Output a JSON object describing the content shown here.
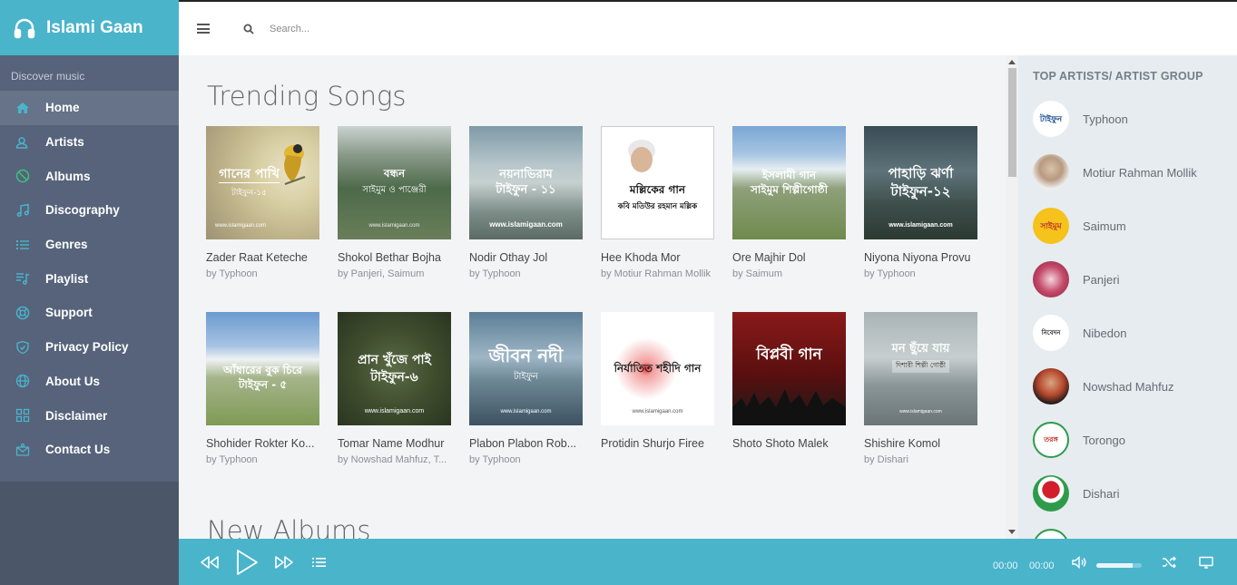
{
  "brand": {
    "title": "Islami Gaan"
  },
  "search": {
    "placeholder": "Search..."
  },
  "sidebar": {
    "caption": "Discover music",
    "items": [
      {
        "label": "Home",
        "icon": "home-icon"
      },
      {
        "label": "Artists",
        "icon": "users-icon"
      },
      {
        "label": "Albums",
        "icon": "disc-icon"
      },
      {
        "label": "Discography",
        "icon": "music-note-icon"
      },
      {
        "label": "Genres",
        "icon": "list-icon"
      },
      {
        "label": "Playlist",
        "icon": "playlist-icon"
      },
      {
        "label": "Support",
        "icon": "support-icon"
      },
      {
        "label": "Privacy Policy",
        "icon": "shield-icon"
      },
      {
        "label": "About Us",
        "icon": "globe-icon"
      },
      {
        "label": "Disclaimer",
        "icon": "grid-icon"
      },
      {
        "label": "Contact Us",
        "icon": "contact-icon"
      }
    ]
  },
  "main": {
    "trending_title": "Trending Songs",
    "new_albums_title": "New Albums",
    "row1": [
      {
        "title": "Zader Raat Keteche",
        "artist": "by Typhoon",
        "cover_title": "গানের পাখি",
        "cover_sub": "টাইফুন-১৫",
        "watermark": "www.islamigaan.com"
      },
      {
        "title": "Shokol Bethar Bojha",
        "artist": "by Panjeri, Saimum",
        "cover_title": "বন্ধন",
        "cover_sub": "সাইমুম ও পাঞ্জেরী",
        "watermark": "www.islamigaan.com"
      },
      {
        "title": "Nodir Othay Jol",
        "artist": "by Typhoon",
        "cover_title": "নয়নাভিরাম",
        "cover_sub": "টাইফুন - ১১",
        "watermark": "www.islamigaan.com"
      },
      {
        "title": "Hee Khoda Mor",
        "artist": "by Motiur Rahman Mollik",
        "cover_title": "মল্লিকের গান",
        "cover_sub": "কবি মতিউর রহমান মল্লিক",
        "watermark": ""
      },
      {
        "title": "Ore Majhir Dol",
        "artist": "by Saimum",
        "cover_title": "ইসলামী গান",
        "cover_sub": "সাইমুম শিল্পীগোষ্ঠী",
        "watermark": ""
      },
      {
        "title": "Niyona Niyona Provu",
        "artist": "by Typhoon",
        "cover_title": "পাহাড়ি ঝর্ণা",
        "cover_sub": "টাইফুন-১২",
        "watermark": "www.islamigaan.com"
      }
    ],
    "row2": [
      {
        "title": "Shohider Rokter Ko...",
        "artist": "by Typhoon",
        "cover_title": "আঁধারের বুক চিরে",
        "cover_sub": "টাইফুন - ৫",
        "watermark": ""
      },
      {
        "title": "Tomar Name Modhur",
        "artist": "by Nowshad Mahfuz, T...",
        "cover_title": "প্রান খুঁজে পাই",
        "cover_sub": "টাইফুন-৬",
        "watermark": "www.islamigaan.com"
      },
      {
        "title": "Plabon Plabon Rob...",
        "artist": "by Typhoon",
        "cover_title": "জীবন নদী",
        "cover_sub": "টাইফুন",
        "watermark": "www.islamigaan.com"
      },
      {
        "title": "Protidin Shurjo Firee",
        "artist": "",
        "cover_title": "নির্যাতিত শহীদি গান",
        "cover_sub": "",
        "watermark": "www.islamigaan.com"
      },
      {
        "title": "Shoto Shoto Malek",
        "artist": "",
        "cover_title": "বিপ্লবী গান",
        "cover_sub": "",
        "watermark": ""
      },
      {
        "title": "Shishire Komol",
        "artist": "by Dishari",
        "cover_title": "মন ছুঁয়ে যায়",
        "cover_sub": "দিশারী শিল্পী গোষ্ঠী",
        "watermark": "www.islamigaan.com"
      }
    ]
  },
  "right_panel": {
    "title": "TOP ARTISTS/ ARTIST GROUP",
    "artists": [
      {
        "name": "Typhoon",
        "logo_text": "টাইফুন"
      },
      {
        "name": "Motiur Rahman Mollik",
        "logo_text": ""
      },
      {
        "name": "Saimum",
        "logo_text": "সাইমুম"
      },
      {
        "name": "Panjeri",
        "logo_text": ""
      },
      {
        "name": "Nibedon",
        "logo_text": "নিবেদন"
      },
      {
        "name": "Nowshad Mahfuz",
        "logo_text": ""
      },
      {
        "name": "Torongo",
        "logo_text": "তরঙ্গ"
      },
      {
        "name": "Dishari",
        "logo_text": ""
      }
    ]
  },
  "player": {
    "current_time": "00:00",
    "duration": "00:00",
    "volume": 0.8
  }
}
